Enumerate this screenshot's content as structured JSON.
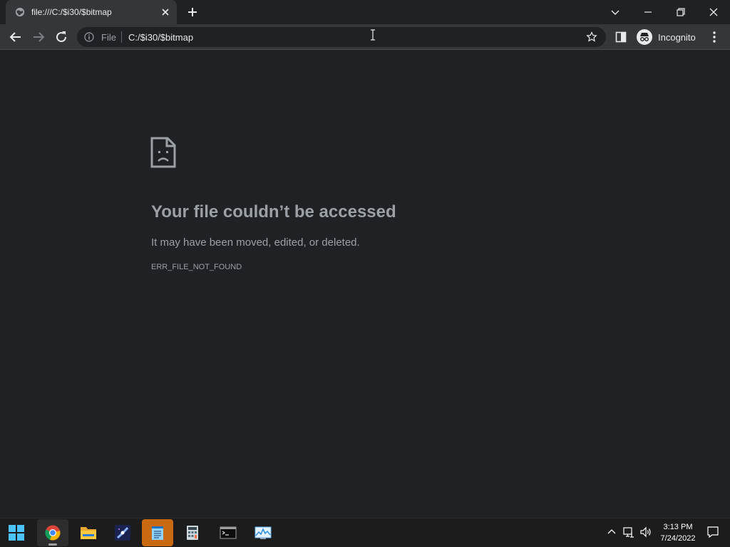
{
  "browser": {
    "tab": {
      "title": "file:///C:/$i30/$bitmap",
      "favicon": "globe-icon"
    },
    "omnibox": {
      "scheme_label": "File",
      "url": "C:/$i30/$bitmap"
    },
    "incognito_label": "Incognito"
  },
  "error_page": {
    "icon": "sad-file-icon",
    "heading": "Your file couldn’t be accessed",
    "description": "It may have been moved, edited, or deleted.",
    "error_code": "ERR_FILE_NOT_FOUND"
  },
  "taskbar": {
    "apps": [
      {
        "name": "start",
        "icon": "windows-start-icon"
      },
      {
        "name": "chrome",
        "icon": "chrome-icon",
        "running": true
      },
      {
        "name": "file-explorer",
        "icon": "folder-icon"
      },
      {
        "name": "media",
        "icon": "galaxy-icon"
      },
      {
        "name": "notepad",
        "icon": "notepad-icon",
        "highlighted": true
      },
      {
        "name": "calculator",
        "icon": "calculator-icon"
      },
      {
        "name": "terminal",
        "icon": "terminal-icon"
      },
      {
        "name": "resource-monitor",
        "icon": "monitor-icon"
      }
    ],
    "clock": {
      "time": "3:13 PM",
      "date": "7/24/2022"
    }
  },
  "colors": {
    "page_background": "#202124",
    "toolbar": "#35363a",
    "text_muted": "#9aa0a6",
    "text_primary": "#e8eaed",
    "highlight_app": "#c96a10"
  }
}
